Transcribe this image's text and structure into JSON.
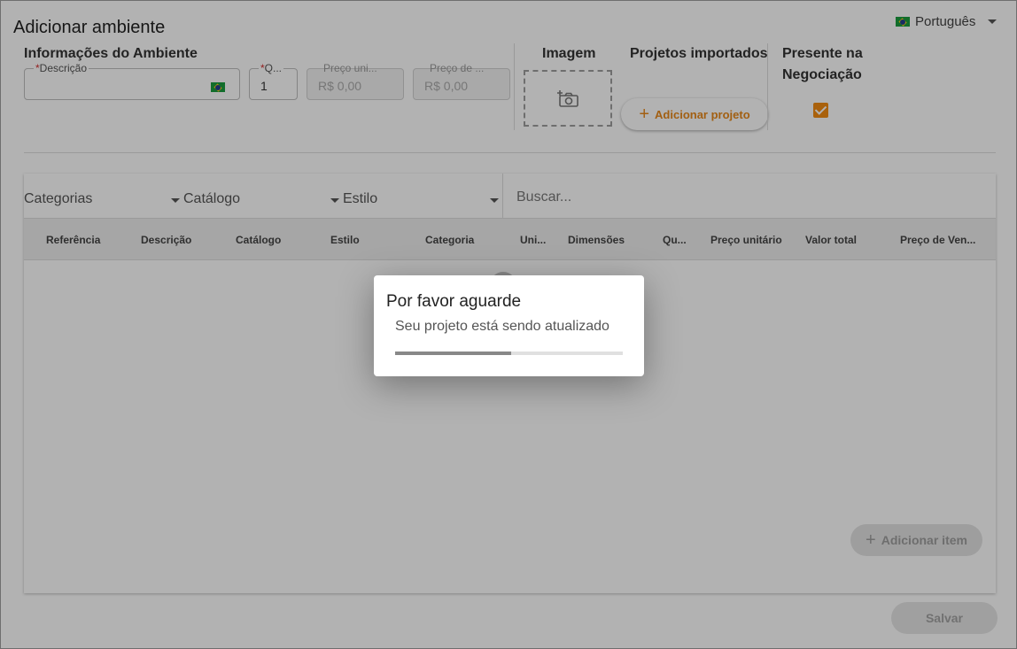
{
  "header": {
    "title": "Adicionar ambiente",
    "language": "Português",
    "language_flag_icon": "brazil-flag-icon"
  },
  "info_section": {
    "title": "Informações do Ambiente",
    "description_field": {
      "required_mark": "*",
      "label": "Descrição",
      "value": ""
    },
    "quantity_field": {
      "required_mark": "*",
      "label": "Q...",
      "value": "1"
    },
    "unit_price_field": {
      "label": "Preço uni...",
      "value": "R$ 0,00"
    },
    "sale_price_field": {
      "label": "Preço de ...",
      "value": "R$ 0,00"
    }
  },
  "image_section": {
    "title": "Imagem",
    "icon": "add-photo-icon"
  },
  "projects_section": {
    "title": "Projetos importados",
    "add_button_label": "Adicionar projeto"
  },
  "negotiation_section": {
    "title_line1": "Presente na",
    "title_line2": "Negociação",
    "checked": true
  },
  "filters": {
    "categories": "Categorias",
    "catalog": "Catálogo",
    "style": "Estilo",
    "search_placeholder": "Buscar..."
  },
  "table": {
    "columns": [
      "Referência",
      "Descrição",
      "Catálogo",
      "Estilo",
      "Categoria",
      "Uni...",
      "Dimensões",
      "Qu...",
      "Preço unitário",
      "Valor total",
      "Preço de Ven..."
    ]
  },
  "actions": {
    "add_item_label": "Adicionar item",
    "save_label": "Salvar"
  },
  "dialog": {
    "title": "Por favor aguarde",
    "message": "Seu projeto está sendo atualizado",
    "progress": 0.51
  },
  "colors": {
    "accent": "#f28c12",
    "overlay": "rgba(0,0,0,0.3)"
  }
}
